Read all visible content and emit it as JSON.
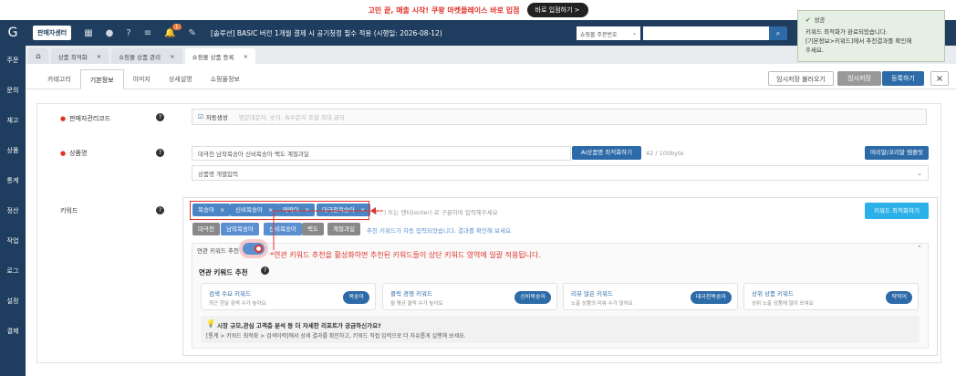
{
  "promo": {
    "text": "고민 끝, 매출 시작! 쿠팡 마켓플레이스 바로 입점",
    "button": "바로 입점하기 >"
  },
  "topbar": {
    "seller_center": "판매자센터",
    "bell_count": "1",
    "notice": "[솔루션] BASIC 버전 1개월 결제 시 공기청정 필수 적용 (시행일: 2026-08-12)",
    "search_type": "쇼핑몰 주문번호"
  },
  "sidebar": [
    "주문",
    "문의",
    "재고",
    "상품",
    "통계",
    "정산",
    "작업",
    "로그",
    "설정",
    "결제"
  ],
  "page_tabs": [
    "상품 최적화",
    "쇼핑몰 상품 관리",
    "쇼핑몰 상품 등록"
  ],
  "sub_tabs": [
    "카테고리",
    "기본정보",
    "이미지",
    "상세설명",
    "쇼핑몰정보"
  ],
  "actions": {
    "load_temp": "임시저장 불러오기",
    "save_temp": "임시저장",
    "register": "등록하기"
  },
  "form": {
    "code_label": "판매자관리코드",
    "auto_label": "자동생성",
    "code_placeholder": "영문대문자, 숫자, 특수문자 조합 최대 글자",
    "name_label": "상품명",
    "name_value": "대극천 남작복숭아 신비복숭아 백도 계절과일",
    "ai_btn": "AI상품명 최적화하기",
    "byte_count": "42 / 100byte",
    "preset_btn": "머리말/꼬리말 템플릿",
    "name_input": "상품명 개별입력",
    "keyword_label": "키워드"
  },
  "keywords": {
    "chips": [
      "복숭아",
      "신비복숭아",
      "딱딱이",
      "대극천복숭아"
    ],
    "hint": "를 구분하여 입력해주세요.",
    "hint_prefix": "( , ) 또는 엔터(enter) 로 구분하여 입력해주세요",
    "optimize_btn": "키워드 최적화하기",
    "suggested": [
      "대극천",
      "남작복숭아",
      "신비복숭아",
      "백도",
      "계절과일"
    ],
    "auto_note": "추천 키워드가 자동 입력되었습니다. 결과를 확인해 보세요.",
    "toggle_label": "연관 키워드 추천",
    "annotation": "*연관 키워드 추천을 활성화하면 추천된 키워드들이 상단 키워드 영역에 일괄 적용됩니다.",
    "rec_title": "연관 키워드 추천",
    "cards": [
      {
        "title": "검색 수요 키워드",
        "desc": "최근 한달 검색 수가 높아요",
        "kw": "복숭아"
      },
      {
        "title": "클릭 경쟁 키워드",
        "desc": "월 평균 클릭 수가 높아요",
        "kw": "신비복숭아"
      },
      {
        "title": "리뷰 많은 키워드",
        "desc": "노출 상품의 리뷰 수가 많아요",
        "kw": "대극천복숭아"
      },
      {
        "title": "상위 상품 키워드",
        "desc": "상위 노출 상품에 많이 쓰여요",
        "kw": "딱딱이"
      }
    ],
    "tip_title": "시장 규모,관심 고객층 분석 등 더 자세한 리포트가 궁금하신가요?",
    "tip_desc": "[통계 > 키워드 최적화 > 검색이력]에서 상세 결과를 확인하고, 키워드 직접 입력으로 더 자유롭게 실행해 보세요."
  },
  "toast": {
    "title": "성공",
    "line1": "키워드 최적화가 완료되었습니다.",
    "line2": "[기본정보>키워드]에서 추천결과를 확인해",
    "line3": "주세요."
  }
}
